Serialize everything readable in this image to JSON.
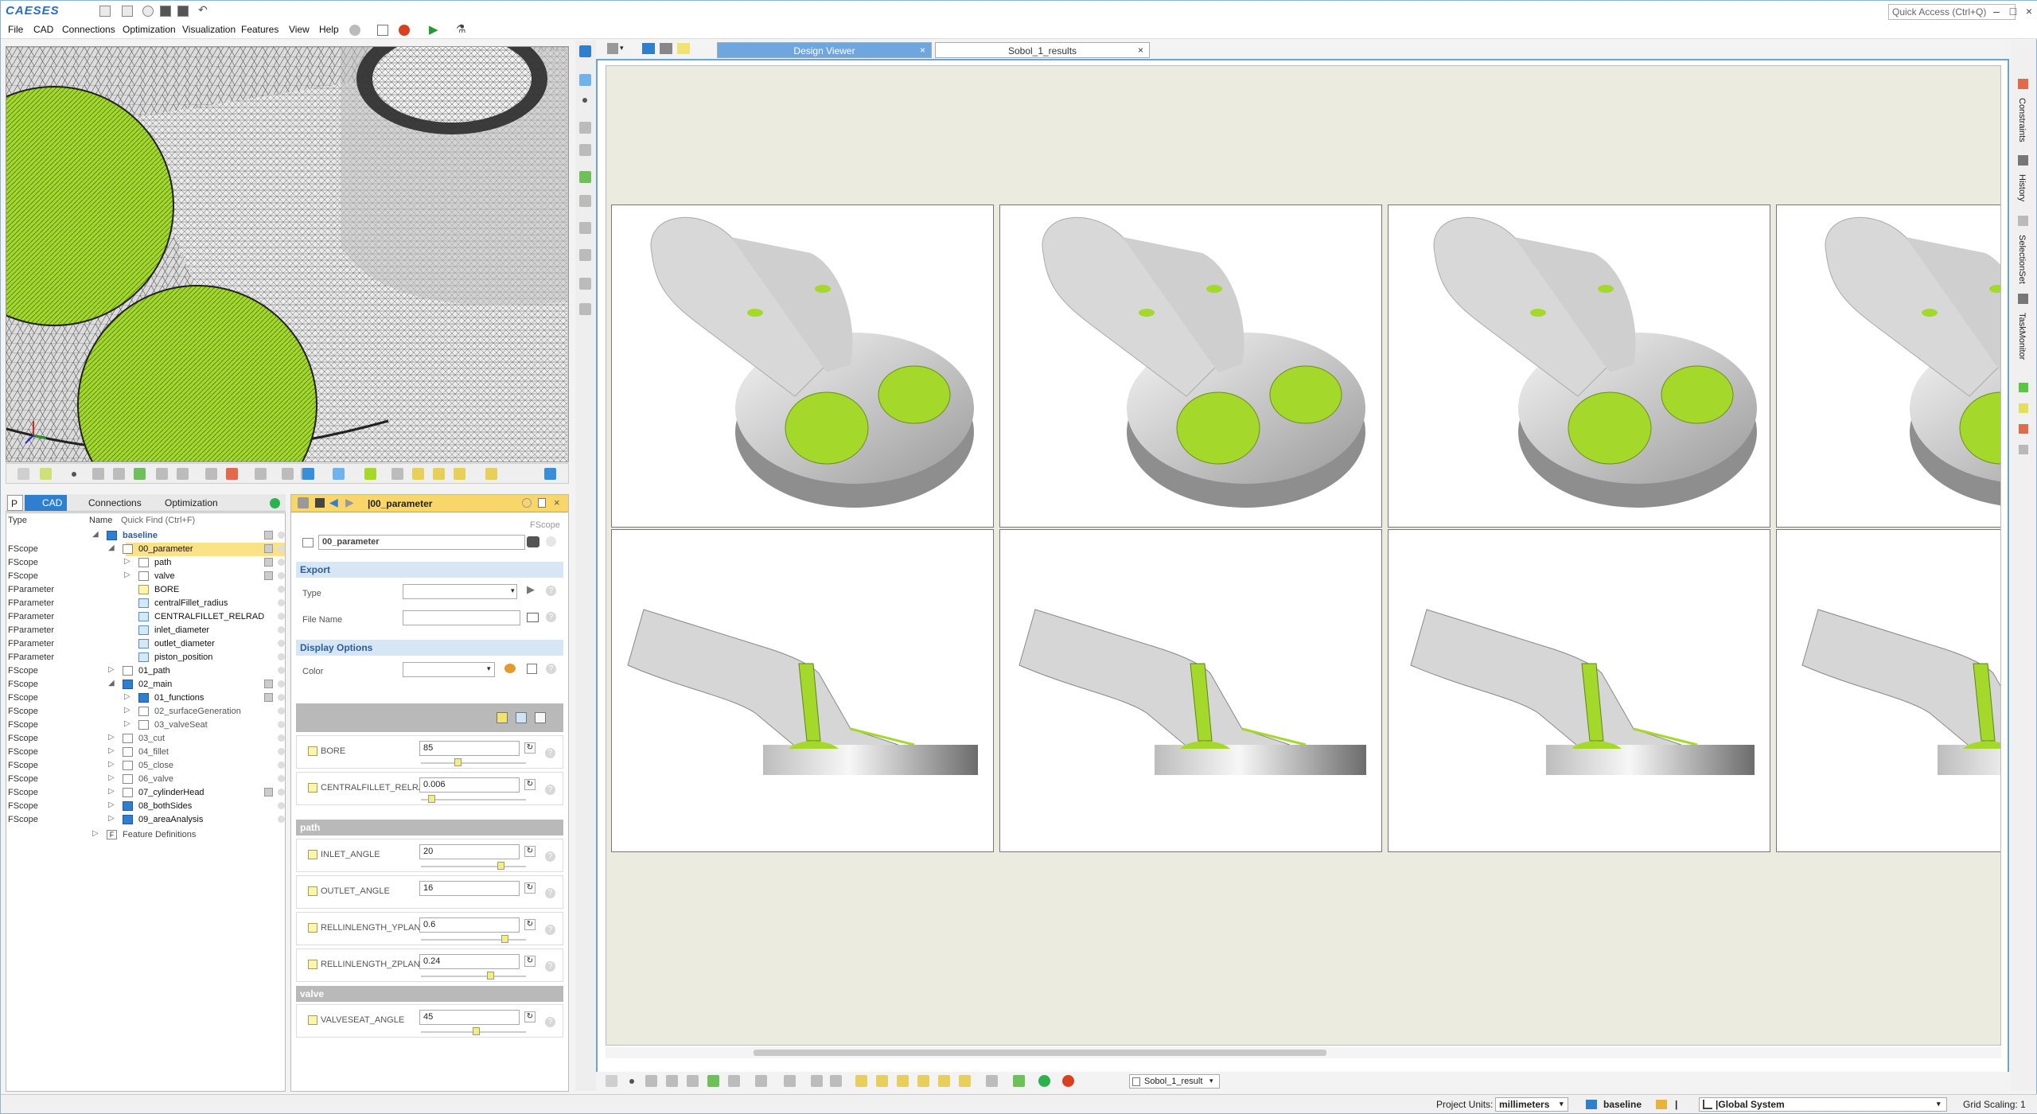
{
  "app": {
    "logo": "CAESES",
    "quick_access_placeholder": "Quick Access (Ctrl+Q)"
  },
  "menu": [
    "File",
    "CAD",
    "Connections",
    "Optimization",
    "Visualization",
    "Features",
    "View",
    "Help"
  ],
  "left_tabs": {
    "p": "P",
    "cad": "CAD",
    "connections": "Connections",
    "optimization": "Optimization"
  },
  "tree": {
    "col_type": "Type",
    "col_name": "Name",
    "quick_find": "Quick Find (Ctrl+F)",
    "rows": [
      {
        "type": "",
        "name": "baseline"
      },
      {
        "type": "FScope",
        "name": "00_parameter"
      },
      {
        "type": "FScope",
        "name": "path"
      },
      {
        "type": "FScope",
        "name": "valve"
      },
      {
        "type": "FParameter",
        "name": "BORE"
      },
      {
        "type": "FParameter",
        "name": "centralFillet_radius"
      },
      {
        "type": "FParameter",
        "name": "CENTRALFILLET_RELRAD"
      },
      {
        "type": "FParameter",
        "name": "inlet_diameter"
      },
      {
        "type": "FParameter",
        "name": "outlet_diameter"
      },
      {
        "type": "FParameter",
        "name": "piston_position"
      },
      {
        "type": "FScope",
        "name": "01_path"
      },
      {
        "type": "FScope",
        "name": "02_main"
      },
      {
        "type": "FScope",
        "name": "01_functions"
      },
      {
        "type": "FScope",
        "name": "02_surfaceGeneration"
      },
      {
        "type": "FScope",
        "name": "03_valveSeat"
      },
      {
        "type": "FScope",
        "name": "03_cut"
      },
      {
        "type": "FScope",
        "name": "04_fillet"
      },
      {
        "type": "FScope",
        "name": "05_close"
      },
      {
        "type": "FScope",
        "name": "06_valve"
      },
      {
        "type": "FScope",
        "name": "07_cylinderHead"
      },
      {
        "type": "FScope",
        "name": "08_bothSides"
      },
      {
        "type": "FScope",
        "name": "09_areaAnalysis"
      },
      {
        "type": "",
        "name": "Feature Definitions"
      }
    ]
  },
  "props": {
    "title": "|00_parameter",
    "scope_type": "FScope",
    "name_value": "00_parameter",
    "export_header": "Export",
    "type_label": "Type",
    "file_name_label": "File Name",
    "display_header": "Display Options",
    "color_label": "Color",
    "params_top": [
      {
        "label": "BORE",
        "value": "85",
        "knob": 0.36
      },
      {
        "label": "CENTRALFILLET_RELRAD",
        "value": "0.006",
        "knob": 0.1
      }
    ],
    "path_header": "path",
    "params_path": [
      {
        "label": "INLET_ANGLE",
        "value": "20",
        "knob": 0.78
      },
      {
        "label": "OUTLET_ANGLE",
        "value": "16",
        "knob": null
      },
      {
        "label": "RELLINLENGTH_YPLANE",
        "value": "0.6",
        "knob": 0.82
      },
      {
        "label": "RELLINLENGTH_ZPLANE",
        "value": "0.24",
        "knob": 0.68
      }
    ],
    "valve_header": "valve",
    "params_valve": [
      {
        "label": "VALVESEAT_ANGLE",
        "value": "45",
        "knob": 0.54
      }
    ]
  },
  "design_viewer": {
    "tab_active": "Design Viewer",
    "tab_other": "Sobol_1_results",
    "result_select": "Sobol_1_result"
  },
  "right_tabs": [
    "Constraints",
    "History",
    "SelectionSet",
    "TaskMonitor"
  ],
  "status_colors": [
    "#5ac742",
    "#e3e055",
    "#e06a4b",
    "#b9b9b9"
  ],
  "statusbar": {
    "units_label": "Project Units:",
    "units_value": "millimeters",
    "scope_value": "baseline",
    "coord_value": "|Global System",
    "grid_scaling": "Grid Scaling: 1"
  },
  "colors": {
    "accent": "#2f7fd1",
    "highlight_green": "#a4d82a",
    "selected_row": "#fce287"
  }
}
